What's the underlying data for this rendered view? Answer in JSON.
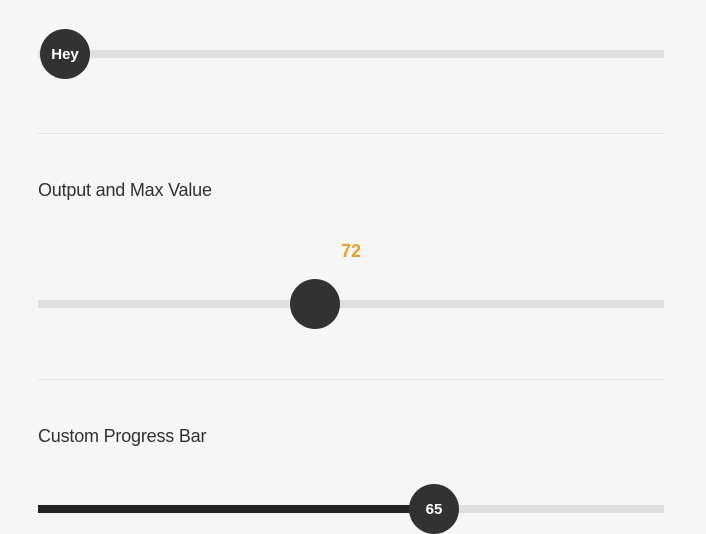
{
  "slider_a": {
    "thumb_label": "Hey"
  },
  "slider_b": {
    "heading": "Output and Max Value",
    "value": "72"
  },
  "slider_c": {
    "heading": "Custom Progress Bar",
    "thumb_label": "65"
  }
}
